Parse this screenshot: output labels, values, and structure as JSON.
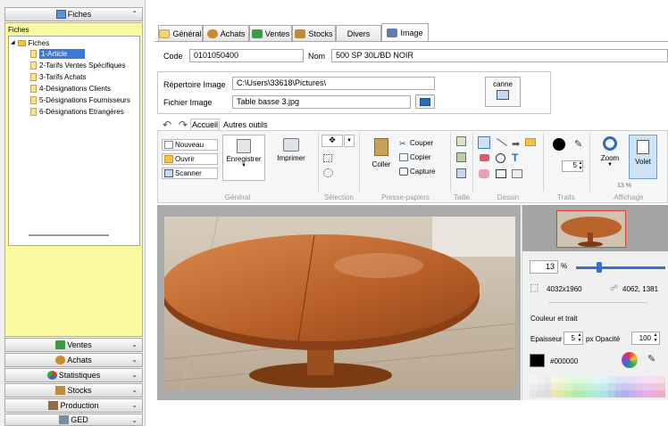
{
  "sidebar": {
    "header": "Fiches",
    "section_label": "Fiches",
    "tree": {
      "root": "Fiches",
      "items": [
        "1-Article",
        "2-Tarifs Ventes Spécifiques",
        "3-Tarifs Achats",
        "4-Désignations Clients",
        "5-Désignations Fournisseurs",
        "6-Désignations Etrangères"
      ]
    },
    "bottom": [
      "Ventes",
      "Achats",
      "Statistiques",
      "Stocks",
      "Production",
      "GED"
    ]
  },
  "tabs": [
    "Général",
    "Achats",
    "Ventes",
    "Stocks",
    "Divers",
    "Image"
  ],
  "form": {
    "code_label": "Code",
    "code_value": "0101050400",
    "nom_label": "Nom",
    "nom_value": "500 SP 30L/BD NOIR",
    "rep_label": "Répertoire Image",
    "rep_value": "C:\\Users\\33618\\Pictures\\",
    "fichier_label": "Fichier Image",
    "fichier_value": "Table basse 3.jpg",
    "scan_label": "canne"
  },
  "ribbon": {
    "tabs": [
      "Accueil",
      "Autres outils"
    ],
    "nouveau": "Nouveau",
    "ouvrir": "Ouvrir",
    "scanner": "Scanner",
    "enregistrer": "Enregistrer",
    "imprimer": "Imprimer",
    "coller": "Coller",
    "couper": "Couper",
    "copier": "Copier",
    "capture": "Capture",
    "trait_value": "5",
    "zoom": "Zoom",
    "volet": "Volet",
    "zoom_pct": "13 %",
    "groups": [
      "Général",
      "Sélection",
      "Presse-papiers",
      "Taille",
      "Dessin",
      "Traits",
      "Affichage"
    ]
  },
  "panel": {
    "zoom_value": "13",
    "zoom_unit": "%",
    "zoom_slider": 0.26,
    "dimensions": "4032x1960",
    "coords": "4062, 1381",
    "couleur_title": "Couleur et trait",
    "epaisseur_label": "Epaisseur",
    "epaisseur_value": "5",
    "px_opacite": "px Opacité",
    "opacite_value": "100",
    "color_hex": "#000000"
  },
  "colors": {
    "fiches_yellow": "#fbf9a0",
    "selection_blue": "#3b78d8",
    "slider_blue": "#2f6fd6"
  }
}
